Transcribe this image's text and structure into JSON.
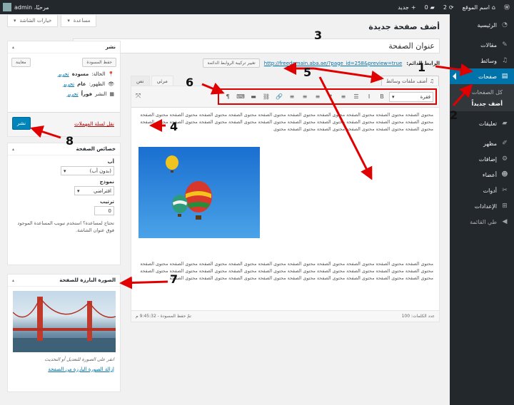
{
  "adminbar": {
    "site_name": "اسم الموقع",
    "updates": "2",
    "comments": "0",
    "new_label": "جديد",
    "greeting": "مرحبًا، admin"
  },
  "sidebar": {
    "items": [
      {
        "label": "الرئيسية",
        "icon": "dashboard-icon",
        "glyph": "◔"
      },
      {
        "label": "مقالات",
        "icon": "pin-icon",
        "glyph": "✎"
      },
      {
        "label": "وسائط",
        "icon": "media-icon",
        "glyph": "♫"
      },
      {
        "label": "صفحات",
        "icon": "pages-icon",
        "glyph": "▤"
      },
      {
        "label": "تعليقات",
        "icon": "comments-icon",
        "glyph": "▰"
      },
      {
        "label": "مظهر",
        "icon": "appearance-icon",
        "glyph": "✐"
      },
      {
        "label": "إضافات",
        "icon": "plugins-icon",
        "glyph": "⚙"
      },
      {
        "label": "أعضاء",
        "icon": "users-icon",
        "glyph": "☻"
      },
      {
        "label": "أدوات",
        "icon": "tools-icon",
        "glyph": "✂"
      },
      {
        "label": "الإعدادات",
        "icon": "settings-icon",
        "glyph": "⊞"
      },
      {
        "label": "طي القائمة",
        "icon": "collapse-icon",
        "glyph": "◀"
      }
    ],
    "sub_all": "كل الصفحات",
    "sub_new": "أضف جديداً"
  },
  "top_tabs": {
    "screen_options": "خيارات الشاشة",
    "help": "مساعدة"
  },
  "page_title": "أضف صفحة جديدة",
  "title_value": "عنوان الصفحة",
  "permalink": {
    "label": "الرابط الدائم:",
    "url": "http://freedomain.aba.ae/?page_id=258&preview=true",
    "change_button": "تغيير تركيبة الروابط الدائمة"
  },
  "editor": {
    "add_media": "أضف ملفات وسائط",
    "tab_visual": "مرئي",
    "tab_text": "نص",
    "format": "فقرة",
    "toolbar_icons": [
      "B",
      "I",
      "☰",
      "≡",
      "❝",
      "≡",
      "≡",
      "≡",
      "🔗",
      "⛓",
      "▬",
      "⌨",
      "¶"
    ],
    "paragraph1": "محتوى الصفحة محتوى الصفحة محتوى الصفحة محتوى الصفحة محتوى الصفحة محتوى الصفحة محتوى الصفحة محتوى الصفحة محتوى الصفحة محتوى الصفحة محتوى الصفحة محتوى الصفحة محتوى الصفحة محتوى الصفحة محتوى الصفحة محتوى الصفحة محتوى الصفحة محتوى الصفحة محتوى الصفحة محتوى الصفحة محتوى الصفحة محتوى الصفحة محتوى الصفحة محتوى الصفحة محتوى الصفحة محتوى",
    "paragraph2": "محتوى الصفحة محتوى الصفحة محتوى الصفحة محتوى الصفحة محتوى الصفحة محتوى الصفحة محتوى الصفحة محتوى الصفحة محتوى الصفحة محتوى الصفحة محتوى الصفحة محتوى الصفحة محتوى الصفحة محتوى الصفحة محتوى الصفحة محتوى الصفحة محتوى الصفحة محتوى الصفحة محتوى الصفحة محتوى الصفحة محتوى الصفحة محتوى الصفحة محتوى الصفحة محتوى الصفحة محتوى الصفحة محتوى الصفحة محتوى الصفحة محتوى الصفحة محتوى الصفحة",
    "word_count": "عدد الكلمات: 100",
    "saved": "تمّ حفظ المسودة - 9:45:32 م"
  },
  "publish": {
    "title": "نشر",
    "save_draft": "حفظ المسودة",
    "preview": "معاينة",
    "status_label": "الحالة:",
    "status_value": "مسودة",
    "visibility_label": "الظهور:",
    "visibility_value": "عام",
    "schedule_label": "النشر",
    "schedule_value": "فوراً",
    "edit": "تحرير",
    "trash": "نقل لسلة المهملات",
    "publish_button": "نشر"
  },
  "attributes": {
    "title": "خصائص الصفحة",
    "parent_label": "أب",
    "parent_value": "(بدون أب)",
    "template_label": "نموذج",
    "template_value": "افتراضي",
    "order_label": "ترتيب",
    "order_value": "0",
    "help_text": "تحتاج لمساعدة؟ استخدم تبويب المساعدة الموجود فوق عنوان الشاشة."
  },
  "featured": {
    "title": "الصورة البارزة للصفحة",
    "hint": "انقر على الصورة للتعديل أو التحديث",
    "remove": "إزالة الصورة البارزة من الصفحة"
  },
  "annotations": [
    "1",
    "2",
    "3",
    "4",
    "5",
    "5",
    "6",
    "7",
    "8"
  ],
  "colors": {
    "accent": "#0073aa",
    "arrow": "#e00000",
    "sidebar": "#23282d"
  }
}
